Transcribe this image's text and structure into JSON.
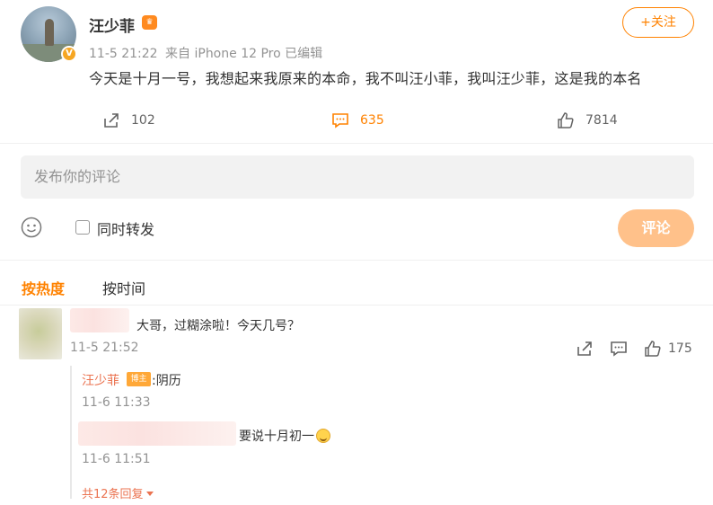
{
  "post": {
    "author": "汪少菲",
    "crown_icon": "crown-badge-icon",
    "verified_icon": "verified-v-icon",
    "time": "11-5 21:22",
    "source": "来自 iPhone 12 Pro",
    "edited": "已编辑",
    "text": "今天是十月一号，我想起来我原来的本命，我不叫汪小菲，我叫汪少菲，这是我的本名",
    "follow_label": "+关注"
  },
  "actions": {
    "repost_count": "102",
    "comment_count": "635",
    "like_count": "7814"
  },
  "composer": {
    "placeholder": "发布你的评论",
    "repost_label": "同时转发",
    "submit_label": "评论"
  },
  "sort": {
    "hot_label": "按热度",
    "time_label": "按时间"
  },
  "comments": [
    {
      "text": "大哥，过糊涂啦！今天几号？",
      "time": "11-5 21:52",
      "like_count": "175",
      "replies": [
        {
          "author": "汪少菲",
          "badge": "博主",
          "text": ":阴历",
          "time": "11-6 11:33"
        },
        {
          "text": "要说十月初一",
          "time": "11-6 11:51"
        }
      ],
      "more_replies": "共12条回复"
    }
  ],
  "colors": {
    "accent": "#ff8200",
    "name_link": "#eb7350",
    "muted": "#939393",
    "submit_disabled": "#ffc18a"
  }
}
